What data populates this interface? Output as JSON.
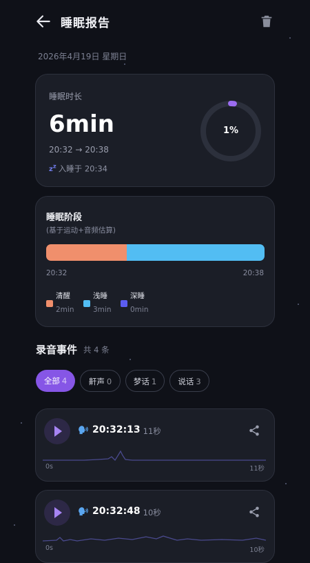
{
  "header": {
    "title": "睡眠报告"
  },
  "date": "2026年4月19日 星期日",
  "summary": {
    "label": "睡眠时长",
    "duration": "6min",
    "time_range": "20:32 → 20:38",
    "fall_asleep": "入睡于 20:34",
    "fall_asleep_icon": "zzz-icon",
    "efficiency_text": "1%",
    "efficiency": 0.01,
    "ring_accent": "#9b6cf0"
  },
  "stages": {
    "title": "睡眠阶段",
    "subtitle": "(基于运动+音频估算)",
    "start": "20:32",
    "end": "20:38",
    "awake_fraction": 0.37,
    "legend": [
      {
        "name": "清醒",
        "value": "2min",
        "color": "#f08f6c"
      },
      {
        "name": "浅睡",
        "value": "3min",
        "color": "#52bdf3"
      },
      {
        "name": "深睡",
        "value": "0min",
        "color": "#5b5cf0"
      }
    ]
  },
  "events": {
    "title": "录音事件",
    "count": "共 4 条",
    "filters": [
      {
        "label": "全部",
        "count": "4",
        "active": true
      },
      {
        "label": "鼾声",
        "count": "0",
        "active": false
      },
      {
        "label": "梦话",
        "count": "1",
        "active": false
      },
      {
        "label": "说话",
        "count": "3",
        "active": false
      }
    ],
    "items": [
      {
        "time": "20:32:13",
        "duration": "11秒",
        "wave_start": "0s",
        "wave_end": "11秒",
        "icon": "speaking-head-icon"
      },
      {
        "time": "20:32:48",
        "duration": "10秒",
        "wave_start": "0s",
        "wave_end": "10秒",
        "icon": "speaking-head-icon"
      }
    ]
  }
}
